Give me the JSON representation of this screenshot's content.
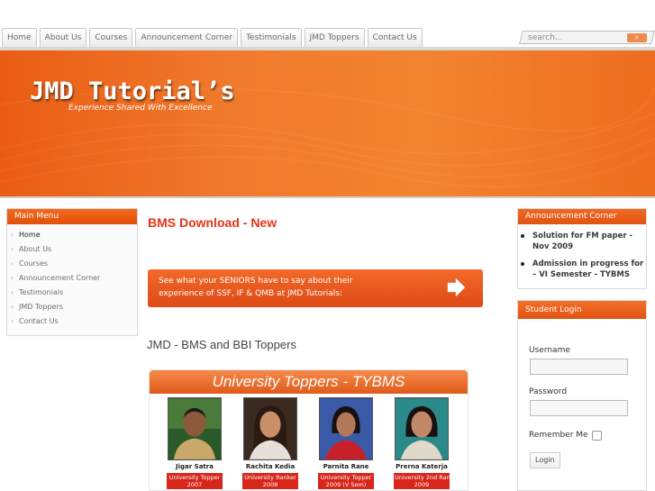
{
  "nav": {
    "tabs": [
      "Home",
      "About Us",
      "Courses",
      "Announcement Corner",
      "Testimonials",
      "JMD Toppers",
      "Contact Us"
    ]
  },
  "search": {
    "placeholder": "search...",
    "button_icon": "search-go-icon"
  },
  "banner": {
    "brand": "JMD Tutorial’s",
    "tagline": "Experience Shared With Excellence"
  },
  "main_menu": {
    "title": "Main Menu",
    "items": [
      "Home",
      "About Us",
      "Courses",
      "Announcement Corner",
      "Testimonials",
      "JMD Toppers",
      "Contact Us"
    ]
  },
  "content": {
    "title": "BMS Download - New",
    "promo": {
      "line1": "See what your SENIORS have to say about their",
      "line2": "experience of SSF, IF & QMB at JMD Tutorials:"
    },
    "section_title": "JMD - BMS and BBI Toppers",
    "toppers": {
      "heading": "University Toppers - TYBMS",
      "people": [
        {
          "name": "Jigar Satra",
          "award1": "University Topper",
          "award2": "2007"
        },
        {
          "name": "Rachita Kedia",
          "award1": "University Ranker",
          "award2": "2008"
        },
        {
          "name": "Parnita Rane",
          "award1": "University Topper",
          "award2": "2009 (V Sem)"
        },
        {
          "name": "Prerna Katerja",
          "award1": "University 2nd Rank",
          "award2": "2009"
        }
      ]
    }
  },
  "announcements": {
    "title": "Announcement Corner",
    "items": [
      "Solution for FM paper - Nov 2009",
      "Admission in progress for – VI Semester - TYBMS"
    ]
  },
  "login": {
    "title": "Student Login",
    "username_label": "Username",
    "password_label": "Password",
    "remember_label": "Remember Me",
    "button_label": "Login"
  },
  "colors": {
    "accent": "#e8321a",
    "banner": "#f07a2c",
    "panel_header": "#e24f08"
  }
}
